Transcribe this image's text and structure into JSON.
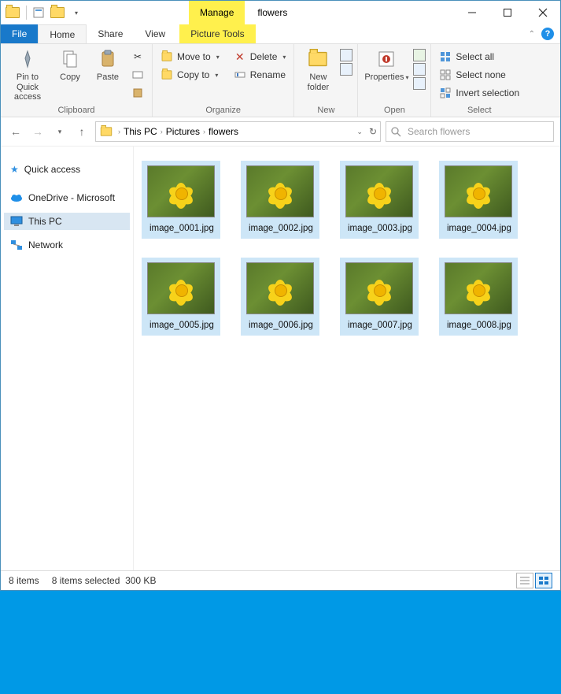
{
  "title": "flowers",
  "context_tab": {
    "group": "Manage",
    "tool": "Picture Tools"
  },
  "tabs": {
    "file": "File",
    "home": "Home",
    "share": "Share",
    "view": "View"
  },
  "ribbon": {
    "clipboard": {
      "label": "Clipboard",
      "pin": "Pin to Quick access",
      "copy": "Copy",
      "paste": "Paste"
    },
    "organize": {
      "label": "Organize",
      "move_to": "Move to",
      "copy_to": "Copy to",
      "delete": "Delete",
      "rename": "Rename"
    },
    "new": {
      "label": "New",
      "new_folder": "New folder"
    },
    "open": {
      "label": "Open",
      "properties": "Properties"
    },
    "select": {
      "label": "Select",
      "select_all": "Select all",
      "select_none": "Select none",
      "invert": "Invert selection"
    }
  },
  "breadcrumbs": [
    "This PC",
    "Pictures",
    "flowers"
  ],
  "search": {
    "placeholder": "Search flowers"
  },
  "tree": {
    "quick_access": "Quick access",
    "onedrive": "OneDrive - Microsoft",
    "this_pc": "This PC",
    "network": "Network"
  },
  "files": [
    {
      "name": "image_0001.jpg"
    },
    {
      "name": "image_0002.jpg"
    },
    {
      "name": "image_0003.jpg"
    },
    {
      "name": "image_0004.jpg"
    },
    {
      "name": "image_0005.jpg"
    },
    {
      "name": "image_0006.jpg"
    },
    {
      "name": "image_0007.jpg"
    },
    {
      "name": "image_0008.jpg"
    }
  ],
  "status": {
    "count": "8 items",
    "selected": "8 items selected",
    "size": "300 KB"
  }
}
